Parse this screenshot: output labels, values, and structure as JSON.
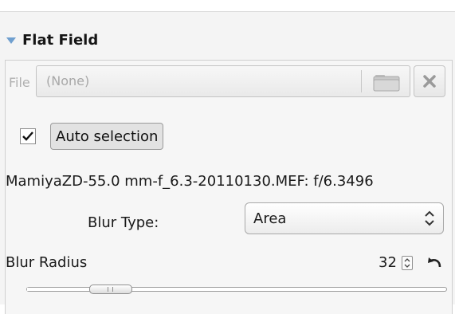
{
  "section": {
    "title": "Flat Field",
    "expanded": true
  },
  "file": {
    "label": "File",
    "value": "(None)",
    "browse_icon": "folder-icon",
    "clear_icon": "close-icon"
  },
  "auto_selection": {
    "checked": true,
    "label": "Auto selection"
  },
  "lens_info": "MamiyaZD-55.0 mm-f_6.3-20110130.MEF: f/6.3496",
  "blur_type": {
    "label": "Blur Type:",
    "value": "Area"
  },
  "blur_radius": {
    "label": "Blur Radius",
    "value": "32",
    "slider_fraction": 0.2
  },
  "colors": {
    "accent": "#6f9fcf",
    "panel_bg": "#f6f6f6"
  }
}
